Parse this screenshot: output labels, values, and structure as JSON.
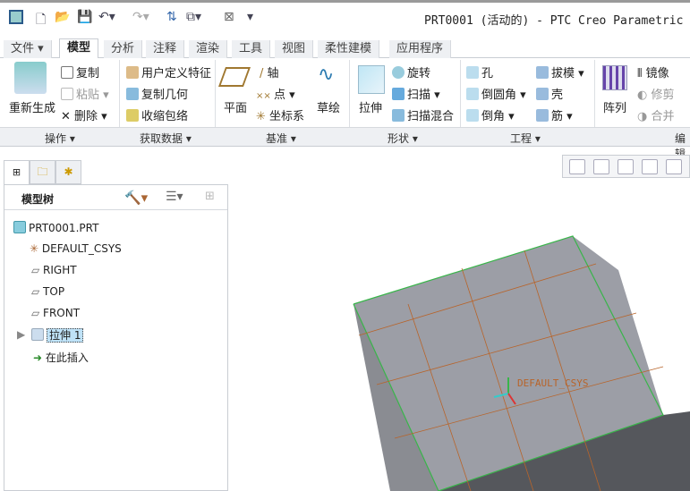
{
  "window": {
    "title": "PRT0001 (活动的) - PTC Creo Parametric"
  },
  "quick_access": [
    "app-icon",
    "new-icon",
    "open-icon",
    "save-icon",
    "undo-icon",
    "redo-icon",
    "regenerate-icon",
    "windows-icon",
    "close-icon",
    "customize-icon"
  ],
  "tabs": [
    {
      "label": "文件 ▾"
    },
    {
      "label": "模型"
    },
    {
      "label": "分析"
    },
    {
      "label": "注释"
    },
    {
      "label": "渲染"
    },
    {
      "label": "工具"
    },
    {
      "label": "视图"
    },
    {
      "label": "柔性建模"
    },
    {
      "label": "应用程序"
    }
  ],
  "ribbon": {
    "regenerate": "重新生成",
    "copy": "复制",
    "paste": "粘贴",
    "delete": "删除",
    "udf": "用户定义特征",
    "copy_geom": "复制几何",
    "shrinkwrap": "收缩包络",
    "plane": "平面",
    "axis": "轴",
    "point": "点",
    "csys": "坐标系",
    "sketch": "草绘",
    "extrude": "拉伸",
    "revolve": "旋转",
    "sweep": "扫描",
    "swept_blend": "扫描混合",
    "hole": "孔",
    "round": "倒圆角",
    "chamfer": "倒角",
    "draft": "拔模",
    "shell": "壳",
    "rib": "筋",
    "pattern": "阵列",
    "mirror": "镜像",
    "trim": "修剪",
    "merge": "合并"
  },
  "groups": [
    "操作 ▾",
    "获取数据 ▾",
    "基准 ▾",
    "形状 ▾",
    "工程 ▾",
    "编辑"
  ],
  "tree": {
    "title": "模型树",
    "items": [
      {
        "label": "PRT0001.PRT",
        "icon": "part-icon"
      },
      {
        "label": "DEFAULT_CSYS",
        "icon": "csys-icon"
      },
      {
        "label": "RIGHT",
        "icon": "plane-icon"
      },
      {
        "label": "TOP",
        "icon": "plane-icon"
      },
      {
        "label": "FRONT",
        "icon": "plane-icon"
      },
      {
        "label": "拉伸 1",
        "icon": "extrude-icon",
        "selected": true
      },
      {
        "label": "在此插入",
        "icon": "insert-arrow-icon"
      }
    ]
  },
  "viewport": {
    "csys_label": "DEFAULT_CSYS"
  },
  "colors": {
    "accent": "#1f6fb0",
    "selection": "#bfe2f7",
    "model_top": "#9c9ea6",
    "model_side": "#55575c",
    "edge": "#39b54a",
    "datum_orange": "#b8642a"
  }
}
